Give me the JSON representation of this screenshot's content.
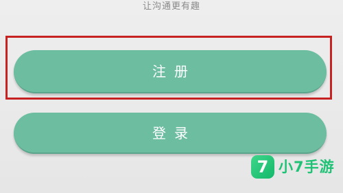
{
  "header": {
    "tagline": "让沟通更有趣"
  },
  "actions": {
    "register_label": "注册",
    "login_label": "登录"
  },
  "watermark": {
    "logo_glyph": "7",
    "text": "小7手游"
  },
  "colors": {
    "button": "#6dbda1",
    "highlight": "#c62222",
    "watermark": "#1fc275"
  }
}
